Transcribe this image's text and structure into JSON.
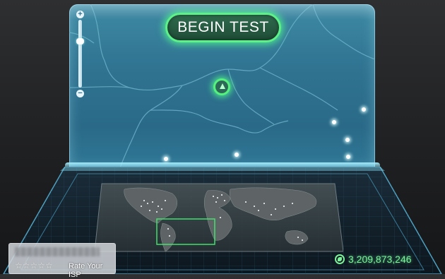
{
  "app": {
    "begin_test_label": "BEGIN TEST",
    "zoom_in_label": "+",
    "zoom_out_label": "−"
  },
  "isp_panel": {
    "stars": "☆☆☆☆☆",
    "rate_label": "Rate Your ISP"
  },
  "stats": {
    "tests_count": "3,209,873,246"
  },
  "colors": {
    "accent_green": "#5ef08a",
    "screen_blue": "#2f7391",
    "counter_green": "#7cf29a"
  },
  "icons": {
    "server": "server-marker-icon",
    "globe": "globe-icon",
    "zoom_in": "zoom-in-icon",
    "zoom_out": "zoom-out-icon"
  }
}
